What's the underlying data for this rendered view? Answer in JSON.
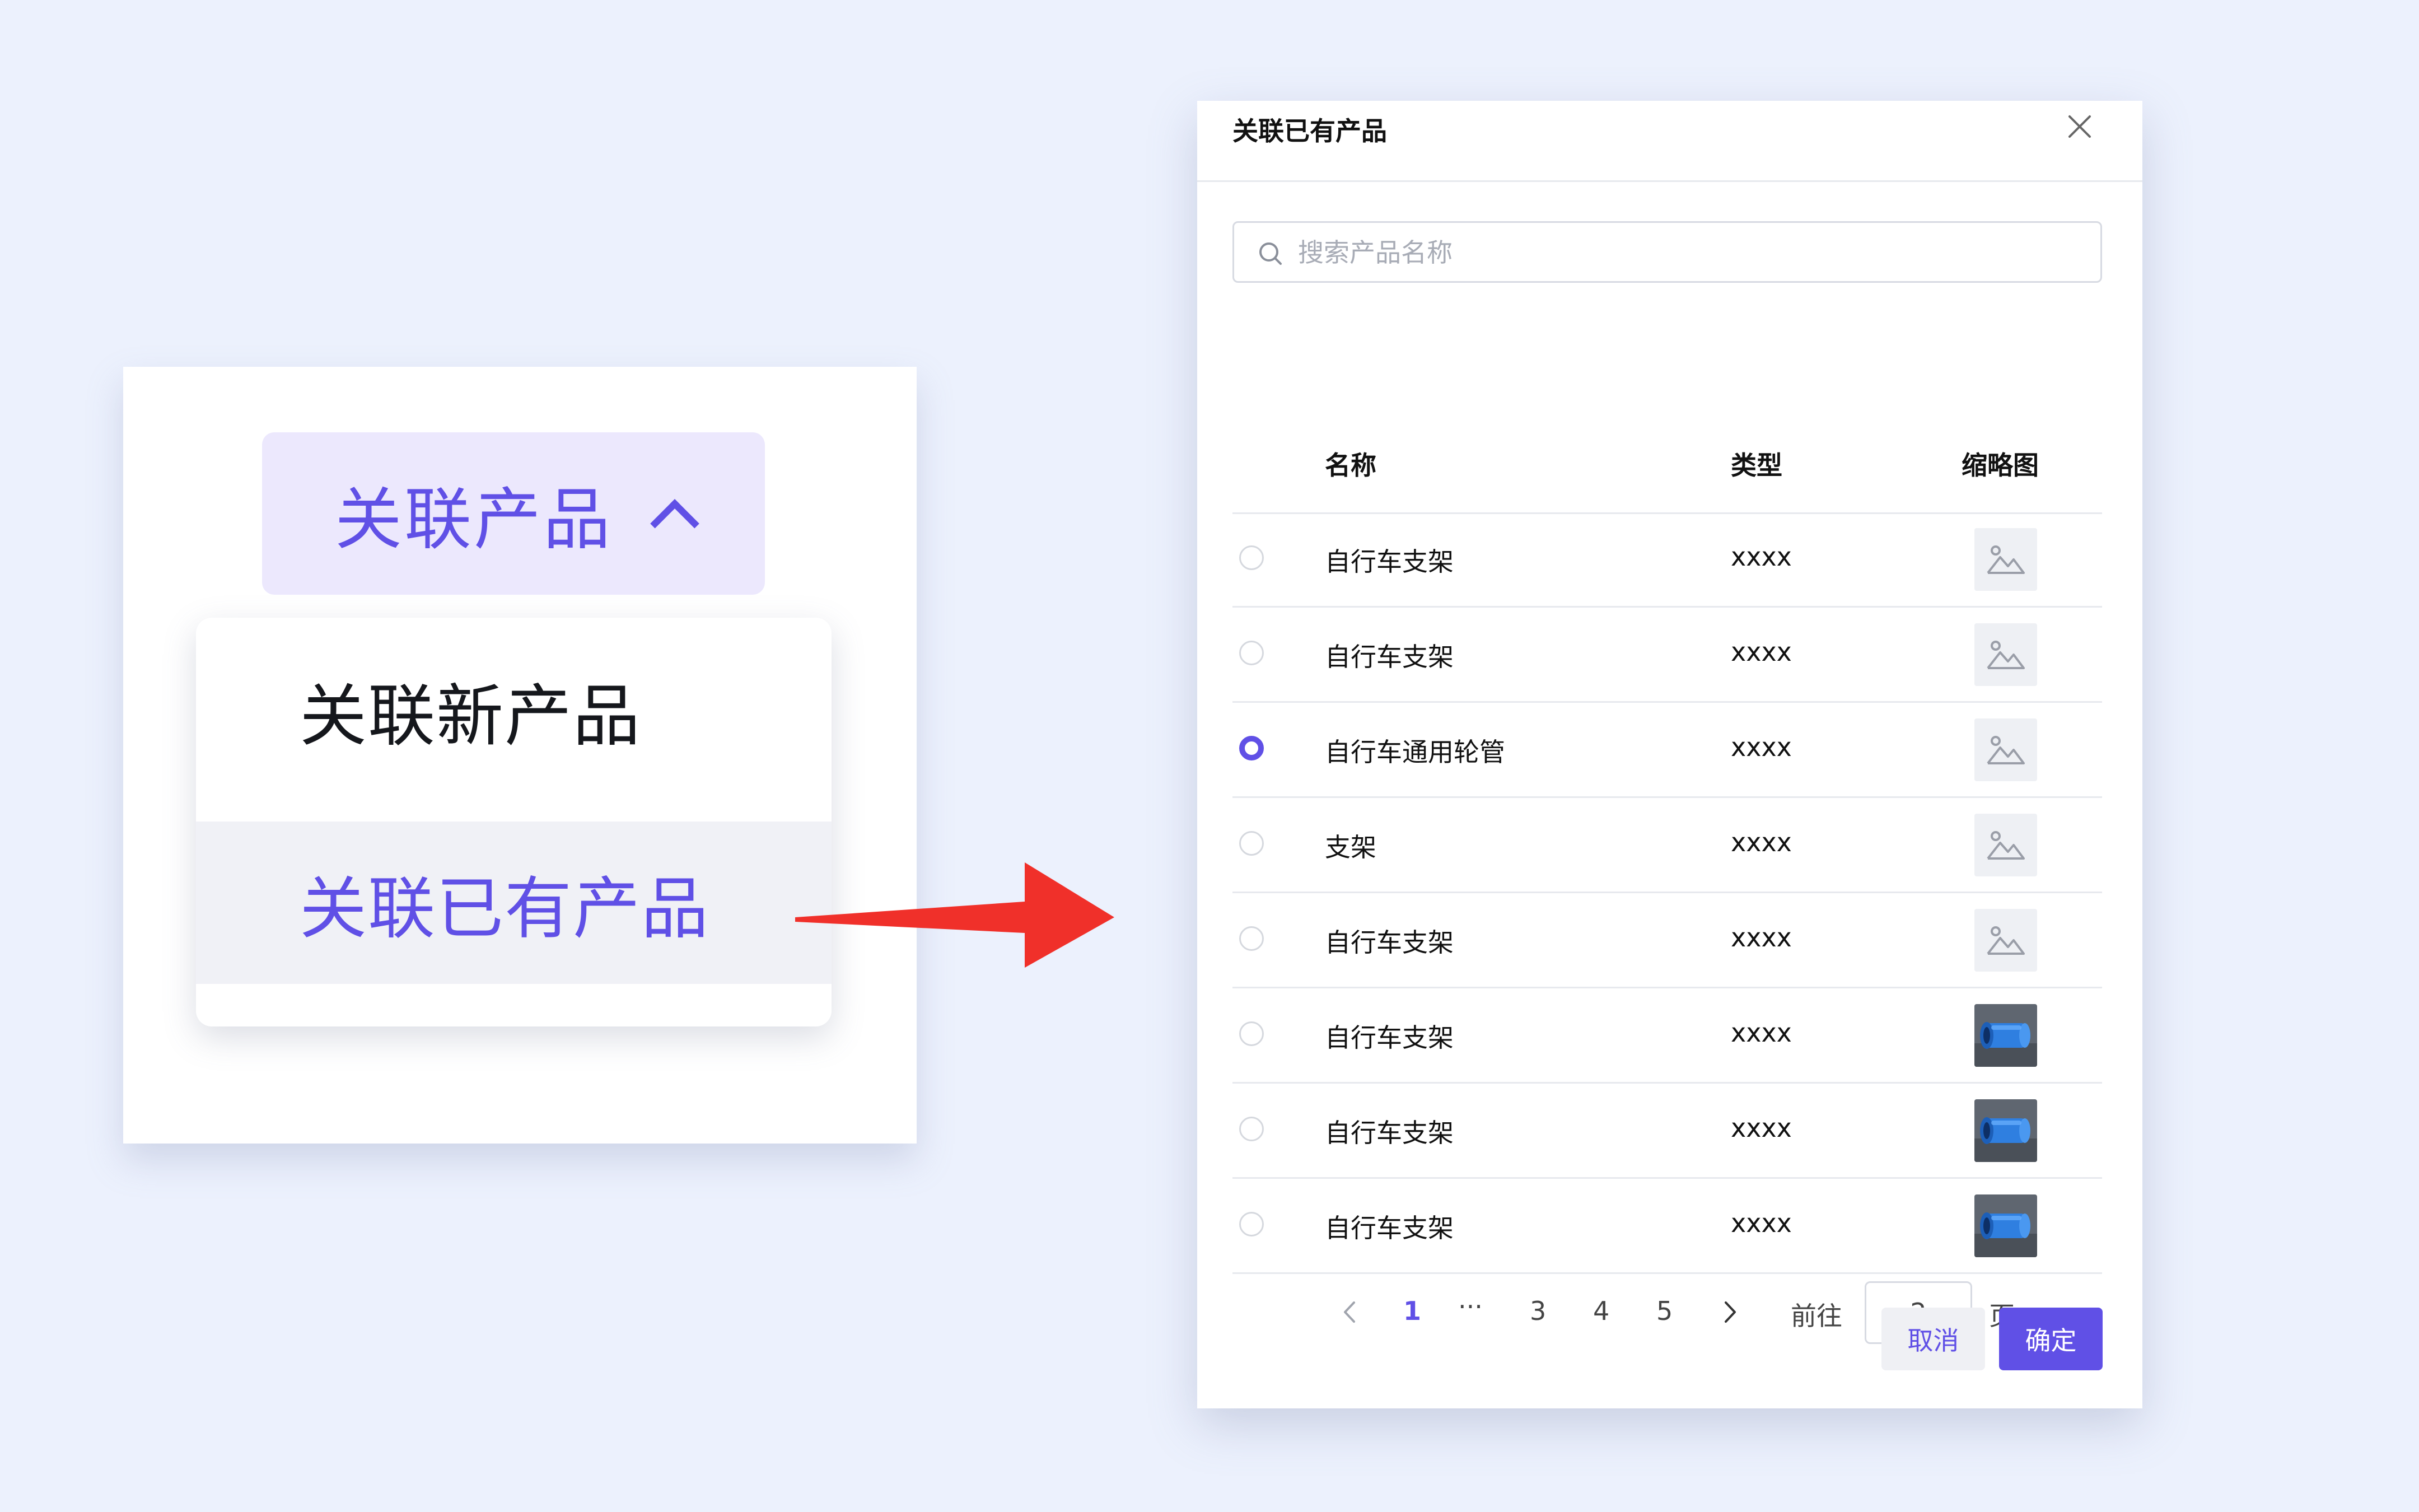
{
  "menu": {
    "trigger_label": "关联产品",
    "trigger_icon": "chevron-up-icon",
    "items": [
      "关联新产品",
      "关联已有产品"
    ],
    "active_index": 1
  },
  "dialog": {
    "title": "关联已有产品",
    "search_placeholder": "搜索产品名称",
    "search_value": "",
    "columns": [
      "名称",
      "类型",
      "缩略图"
    ],
    "rows": [
      {
        "name": "自行车支架",
        "type": "xxxx",
        "selected": false,
        "thumbnail": "image-placeholder-icon"
      },
      {
        "name": "自行车支架",
        "type": "xxxx",
        "selected": false,
        "thumbnail": "image-placeholder-icon"
      },
      {
        "name": "自行车通用轮管",
        "type": "xxxx",
        "selected": true,
        "thumbnail": "image-placeholder-icon"
      },
      {
        "name": "支架",
        "type": "xxxx",
        "selected": false,
        "thumbnail": "image-placeholder-icon"
      },
      {
        "name": "自行车支架",
        "type": "xxxx",
        "selected": false,
        "thumbnail": "image-placeholder-icon"
      },
      {
        "name": "自行车支架",
        "type": "xxxx",
        "selected": false,
        "thumbnail": "blue-tube-product-image"
      },
      {
        "name": "自行车支架",
        "type": "xxxx",
        "selected": false,
        "thumbnail": "blue-tube-product-image"
      },
      {
        "name": "自行车支架",
        "type": "xxxx",
        "selected": false,
        "thumbnail": "blue-tube-product-image"
      }
    ],
    "pagination": {
      "pages": [
        "1",
        "···",
        "3",
        "4",
        "5"
      ],
      "current": "1",
      "goto_label": "前往",
      "goto_value": "2",
      "page_suffix": "页"
    },
    "cancel_label": "取消",
    "confirm_label": "确定"
  },
  "colors": {
    "accent": "#6050e6",
    "background": "#ecf1fd",
    "arrow": "#f0302a"
  }
}
